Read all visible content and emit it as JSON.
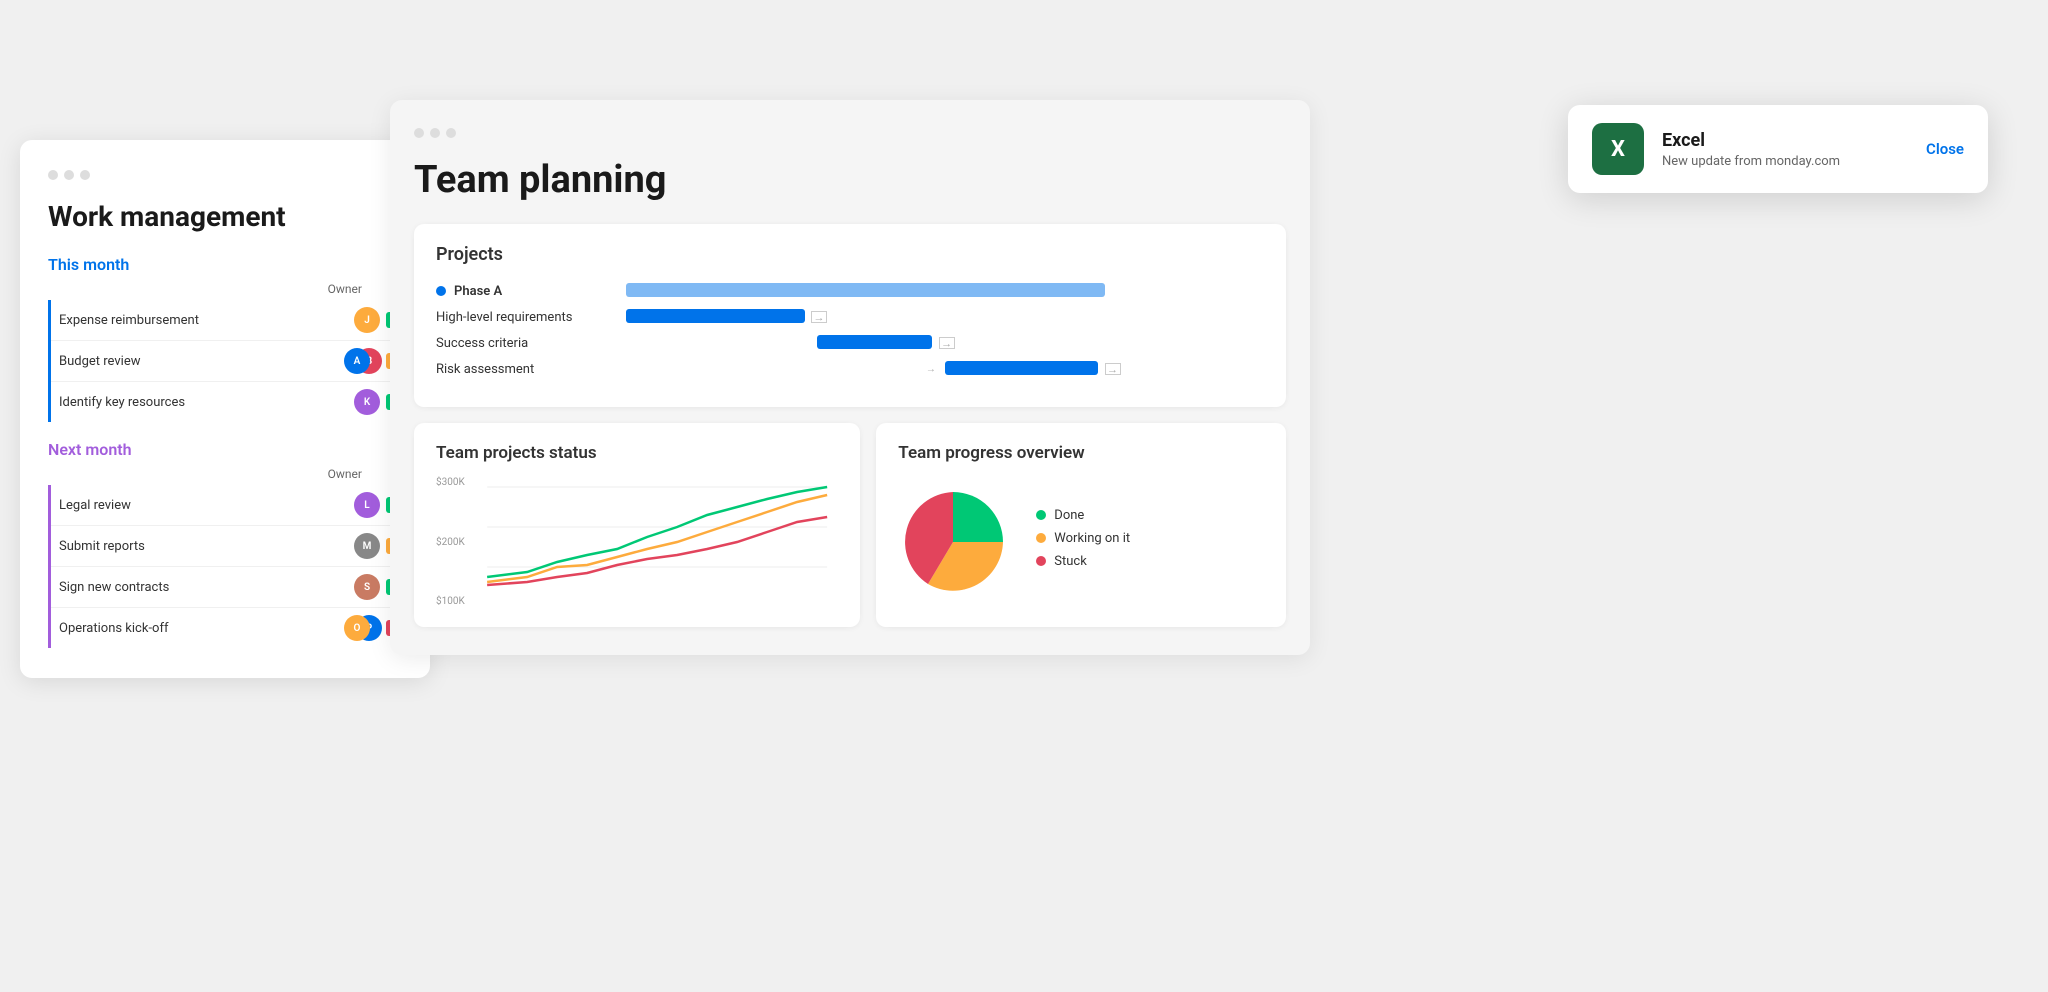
{
  "workManagement": {
    "title": "Work management",
    "thisMonth": {
      "label": "This month",
      "ownerHeader": "Owner",
      "items": [
        {
          "text": "Expense reimbursement",
          "avatarColor": "#fdab3d",
          "avatarInitial": "J",
          "statusColor": "green"
        },
        {
          "text": "Budget review",
          "avatarColor": "#0073ea",
          "avatarInitial": "AB",
          "statusColor": "orange",
          "doubleAvatar": true
        },
        {
          "text": "Identify key resources",
          "avatarColor": "#e2445c",
          "avatarInitial": "K",
          "statusColor": "green"
        }
      ]
    },
    "nextMonth": {
      "label": "Next month",
      "ownerHeader": "Owner",
      "items": [
        {
          "text": "Legal review",
          "avatarColor": "#a25ddc",
          "avatarInitial": "L",
          "statusColor": "green"
        },
        {
          "text": "Submit reports",
          "avatarColor": "#666",
          "avatarInitial": "M",
          "statusColor": "orange"
        },
        {
          "text": "Sign new contracts",
          "avatarColor": "#c97b63",
          "avatarInitial": "S",
          "statusColor": "green"
        },
        {
          "text": "Operations kick-off",
          "avatarColor": "#fdab3d",
          "avatarInitial": "OP",
          "statusColor": "red",
          "doubleAvatar": true
        }
      ]
    }
  },
  "teamPlanning": {
    "title": "Team planning",
    "projects": {
      "title": "Projects",
      "phaseA": "Phase A",
      "ganttRows": [
        {
          "label": "High-level requirements",
          "barLeft": "10%",
          "barWidth": "28%",
          "arrowLeft": "39%",
          "arrowTop": "50%",
          "isPhase": false
        },
        {
          "label": "Success criteria",
          "barLeft": "28%",
          "barWidth": "18%",
          "arrowLeft": "47%",
          "isPhase": false
        },
        {
          "label": "Risk assessment",
          "barLeft": "45%",
          "barWidth": "22%",
          "isPhase": false
        }
      ]
    },
    "teamStatus": {
      "title": "Team projects status",
      "yLabels": [
        "$300K",
        "$200K",
        "$100K"
      ]
    },
    "teamProgress": {
      "title": "Team progress overview",
      "legend": [
        {
          "label": "Done",
          "color": "#00c875"
        },
        {
          "label": "Working on it",
          "color": "#fdab3d"
        },
        {
          "label": "Stuck",
          "color": "#e2445c"
        }
      ]
    }
  },
  "notification": {
    "appName": "Excel",
    "message": "New update from monday.com",
    "closeLabel": "Close",
    "iconBg": "#1d6f42",
    "iconText": "X"
  }
}
